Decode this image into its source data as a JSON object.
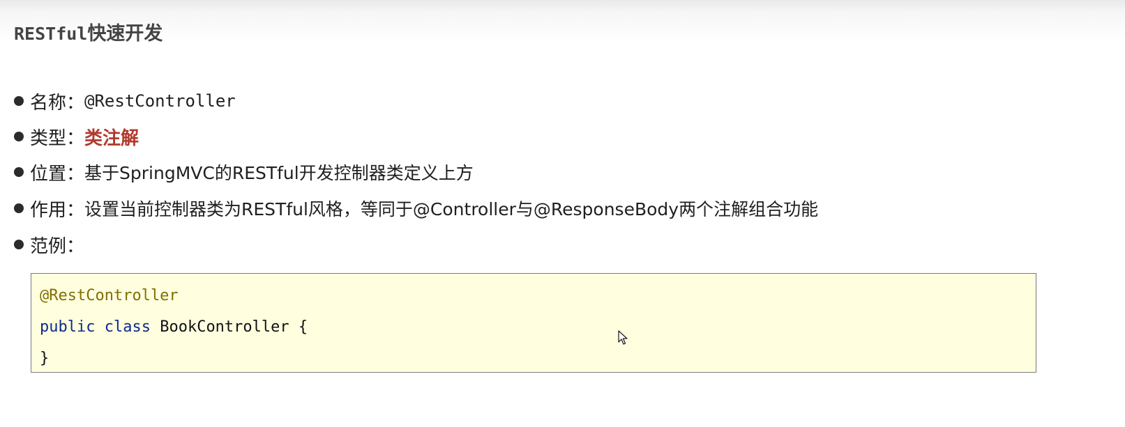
{
  "page": {
    "title_prefix": "RESTful",
    "title_suffix": "快速开发"
  },
  "bullets": [
    {
      "label": "名称：",
      "value": "@RestController"
    },
    {
      "label": "类型：",
      "value": "类注解",
      "color": "#b03a2e"
    },
    {
      "label": "位置：",
      "value": "基于SpringMVC的RESTful开发控制器类定义上方"
    },
    {
      "label": "作用：",
      "value": "设置当前控制器类为RESTful风格，等同于@Controller与@ResponseBody两个注解组合功能"
    },
    {
      "label": "范例：",
      "value": ""
    }
  ],
  "code_example": {
    "line1": "@RestController",
    "line2_keyword1": "public",
    "line2_keyword2": "class",
    "line2_rest": " BookController {",
    "line3": "}"
  },
  "colors": {
    "annotation": "#807000",
    "keyword": "#0d2b8a",
    "code_background": "#ffffe0"
  },
  "icons": {
    "cursor": "mouse-pointer-icon"
  }
}
